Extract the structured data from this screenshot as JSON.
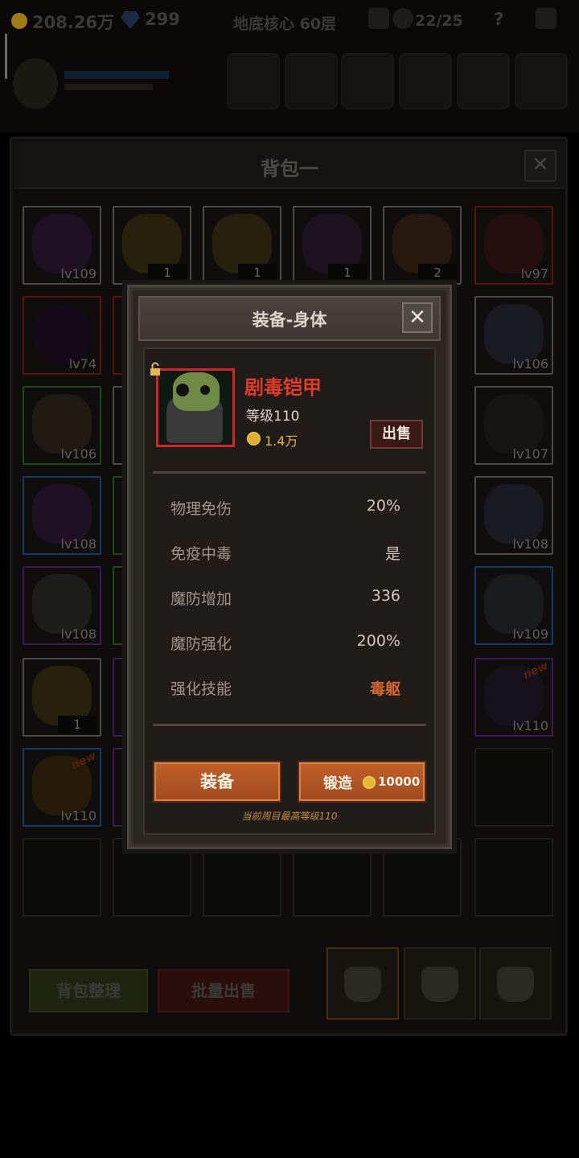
{
  "hud": {
    "gold": "208.26万",
    "gems": "299",
    "location": "地底核心 60层",
    "kills": "22/25",
    "help": "?"
  },
  "backpack": {
    "title": "背包一",
    "close": "✕",
    "cells": [
      {
        "lv": "lv109"
      },
      {
        "count": "1"
      },
      {
        "count": "1"
      },
      {
        "count": "1"
      },
      {
        "count": "2"
      },
      {
        "lv": "lv97"
      },
      {
        "lv": "lv74"
      },
      {
        "lv": "lv106"
      },
      {
        "lv": "lv106"
      },
      {
        "lv": "lv107"
      },
      {
        "lv": "lv108"
      },
      {
        "lv": "lv108"
      },
      {
        "lv": "lv108"
      },
      {
        "lv": "lv109"
      },
      {
        "count": "1"
      },
      {
        "lv": "lv110",
        "badge": "new"
      },
      {
        "lv": "lv110",
        "badge": "new"
      }
    ],
    "sort_button": "背包整理",
    "bulk_sell_button": "批量出售"
  },
  "dialog": {
    "title": "装备-身体",
    "close": "✕",
    "item": {
      "name": "剧毒铠甲",
      "level": "等级110",
      "price": "1.4万",
      "sell": "出售",
      "name_color": "#e33a2a"
    },
    "stats": [
      {
        "label": "物理免伤",
        "value": "20%"
      },
      {
        "label": "免疫中毒",
        "value": "是"
      },
      {
        "label": "魔防增加",
        "value": "336"
      },
      {
        "label": "魔防强化",
        "value": "200%"
      },
      {
        "label": "强化技能",
        "value": "毒躯"
      }
    ],
    "equip_button": "装备",
    "forge_button": "锻造",
    "forge_cost": "10000",
    "max_level_note": "当前周目最高等级110"
  }
}
